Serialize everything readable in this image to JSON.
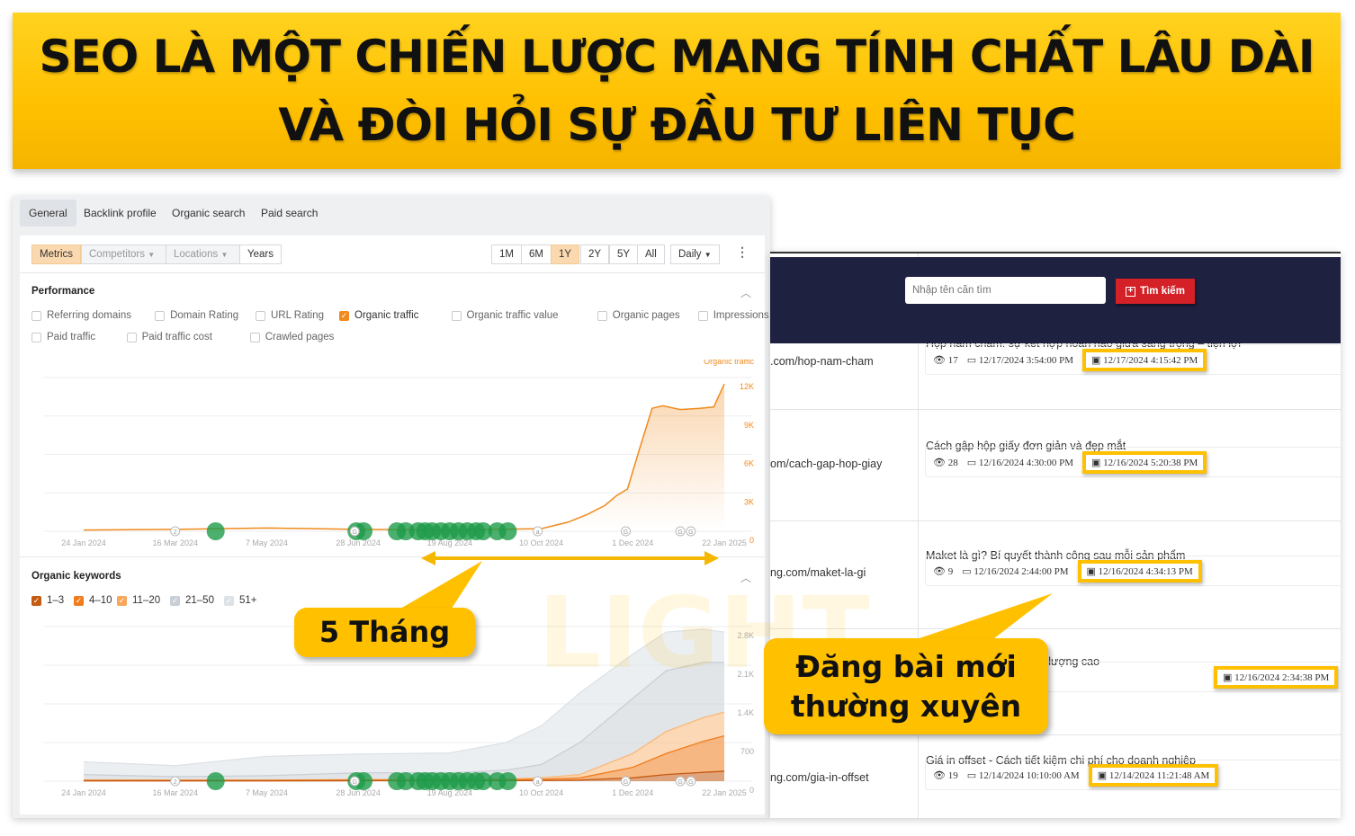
{
  "banner": {
    "line1": "SEO LÀ MỘT CHIẾN LƯỢC MANG TÍNH CHẤT LÂU DÀI",
    "line2": "VÀ ĐÒI HỎI SỰ ĐẦU TƯ LIÊN TỤC"
  },
  "tabs": [
    "General",
    "Backlink profile",
    "Organic search",
    "Paid search"
  ],
  "toolbar": {
    "filters": [
      "Metrics",
      "Competitors",
      "Locations",
      "Years"
    ],
    "ranges": [
      "1M",
      "6M",
      "1Y",
      "2Y",
      "5Y",
      "All"
    ],
    "active_range": "1Y",
    "interval": "Daily"
  },
  "performance": {
    "title": "Performance",
    "metrics": [
      {
        "label": "Referring domains",
        "checked": false
      },
      {
        "label": "Domain Rating",
        "checked": false
      },
      {
        "label": "URL Rating",
        "checked": false
      },
      {
        "label": "Organic traffic",
        "checked": true
      },
      {
        "label": "Organic traffic value",
        "checked": false
      },
      {
        "label": "Organic pages",
        "checked": false
      },
      {
        "label": "Impressions",
        "checked": false
      },
      {
        "label": "Paid traffic",
        "checked": false
      },
      {
        "label": "Paid traffic cost",
        "checked": false
      },
      {
        "label": "Crawled pages",
        "checked": false
      }
    ]
  },
  "keywords": {
    "title": "Organic keywords",
    "buckets": [
      {
        "label": "1–3",
        "checked": true,
        "color": "#c55a11"
      },
      {
        "label": "4–10",
        "checked": true,
        "color": "#f07c1c"
      },
      {
        "label": "11–20",
        "checked": true,
        "color": "#f9a65a"
      },
      {
        "label": "21–50",
        "checked": true,
        "color": "#c9cfd6"
      },
      {
        "label": "51+",
        "checked": true,
        "color": "#dde2e7"
      }
    ]
  },
  "chart_data": [
    {
      "type": "area",
      "series": [
        {
          "name": "Organic traffic",
          "color": "#f08a1c",
          "x": [
            "2024-01-24",
            "2024-03-16",
            "2024-05-07",
            "2024-06-28",
            "2024-08-19",
            "2024-10-10",
            "2024-10-25",
            "2024-11-05",
            "2024-11-15",
            "2024-11-22",
            "2024-11-28",
            "2024-12-05",
            "2024-12-12",
            "2024-12-18",
            "2024-12-28",
            "2025-01-08",
            "2025-01-16",
            "2025-01-22"
          ],
          "y": [
            100,
            150,
            250,
            150,
            100,
            200,
            700,
            1300,
            2000,
            2800,
            3300,
            6500,
            9600,
            9800,
            9500,
            9600,
            9700,
            11500
          ]
        }
      ],
      "yticks": [
        "0",
        "3K",
        "6K",
        "9K",
        "12K"
      ],
      "ylim": [
        0,
        12000
      ],
      "xticks": [
        "24 Jan 2024",
        "16 Mar 2024",
        "7 May 2024",
        "28 Jun 2024",
        "19 Aug 2024",
        "10 Oct 2024",
        "1 Dec 2024",
        "22 Jan 2025"
      ],
      "xlim": [
        "2024-01-24",
        "2025-01-22"
      ],
      "grid": true,
      "legend": "top-right"
    },
    {
      "type": "area",
      "stacked": true,
      "x": [
        "2024-01-24",
        "2024-03-16",
        "2024-05-07",
        "2024-06-28",
        "2024-08-19",
        "2024-09-20",
        "2024-10-10",
        "2024-11-01",
        "2024-12-01",
        "2024-12-20",
        "2025-01-10",
        "2025-01-22"
      ],
      "series": [
        {
          "name": "1–3",
          "color": "#c55a11",
          "values": [
            5,
            5,
            5,
            8,
            8,
            10,
            12,
            20,
            60,
            120,
            160,
            180
          ]
        },
        {
          "name": "4–10",
          "color": "#f07c1c",
          "values": [
            10,
            10,
            10,
            12,
            12,
            15,
            23,
            40,
            190,
            380,
            560,
            640
          ]
        },
        {
          "name": "11–20",
          "color": "#f9b87a",
          "values": [
            5,
            5,
            5,
            10,
            10,
            15,
            25,
            60,
            250,
            400,
            430,
            430
          ]
        },
        {
          "name": "21–50",
          "color": "#c9cfd6",
          "values": [
            100,
            60,
            80,
            120,
            120,
            160,
            240,
            580,
            1000,
            1100,
            1000,
            900
          ]
        },
        {
          "name": "51+",
          "color": "#dde2e7",
          "values": [
            230,
            200,
            350,
            340,
            360,
            500,
            700,
            900,
            800,
            700,
            600,
            550
          ]
        }
      ],
      "yticks": [
        "0",
        "700",
        "1.4K",
        "2.1K",
        "2.8K"
      ],
      "ylim": [
        0,
        2800
      ],
      "xticks": [
        "24 Jan 2024",
        "16 Mar 2024",
        "7 May 2024",
        "28 Jun 2024",
        "19 Aug 2024",
        "10 Oct 2024",
        "1 Dec 2024",
        "22 Jan 2025"
      ],
      "xlim": [
        "2024-01-24",
        "2025-01-22"
      ],
      "grid": true
    }
  ],
  "events": [
    "2024-04-08",
    "2024-06-27",
    "2024-07-01",
    "2024-07-20",
    "2024-07-25",
    "2024-08-01",
    "2024-08-05",
    "2024-08-09",
    "2024-08-14",
    "2024-08-19",
    "2024-08-24",
    "2024-08-29",
    "2024-09-03",
    "2024-09-07",
    "2024-09-15",
    "2024-09-21"
  ],
  "annotations": [
    {
      "date": "2024-03-16",
      "label": "2"
    },
    {
      "date": "2024-06-26",
      "label": "G"
    },
    {
      "date": "2024-10-08",
      "label": "a"
    },
    {
      "date": "2024-11-27",
      "label": "G"
    },
    {
      "date": "2024-12-28",
      "label": "G"
    },
    {
      "date": "2025-01-03",
      "label": "G"
    }
  ],
  "callouts": {
    "months": "5 Tháng",
    "posting_line1": "Đăng bài mới",
    "posting_line2": "thường xuyên"
  },
  "posts": {
    "search_placeholder": "Nhập tên cần tìm",
    "search_button": "Tìm kiếm",
    "rows": [
      {
        "url": ".com/hop-nam-cham",
        "title": "Hộp nam châm: sự kết hợp hoàn hảo giữa sang trọng – tiện lợi",
        "views": "17",
        "created": "12/17/2024 3:54:00 PM",
        "updated": "12/17/2024 4:15:42 PM"
      },
      {
        "url": "om/cach-gap-hop-giay",
        "title": "Cách gập hộp giấy đơn giản và đẹp mắt",
        "views": "28",
        "created": "12/16/2024 4:30:00 PM",
        "updated": "12/16/2024 5:20:38 PM"
      },
      {
        "url": "ng.com/maket-la-gi",
        "title": "Maket là gì? Bí quyết thành công sau mỗi sản phẩm",
        "views": "9",
        "created": "12/16/2024 2:44:00 PM",
        "updated": "12/16/2024 4:34:13 PM"
      },
      {
        "url": "",
        "title": "ệ in carton hiện đại chất lượng cao",
        "views": "",
        "created": "",
        "updated": "12/16/2024 2:34:38 PM"
      },
      {
        "url": "ng.com/gia-in-offset",
        "title": "Giá in offset - Cách tiết kiệm chi phí cho doanh nghiệp",
        "views": "19",
        "created": "12/14/2024 10:10:00 AM",
        "updated": "12/14/2024 11:21:48 AM"
      }
    ]
  },
  "watermark": {
    "brand": "LIGHT",
    "tagline": "Nhanh - Chu"
  },
  "colors": {
    "accent": "#ffc000",
    "traffic": "#f08a1c",
    "event": "#1e9b4a",
    "header": "#1f2140",
    "button": "#d42127"
  }
}
